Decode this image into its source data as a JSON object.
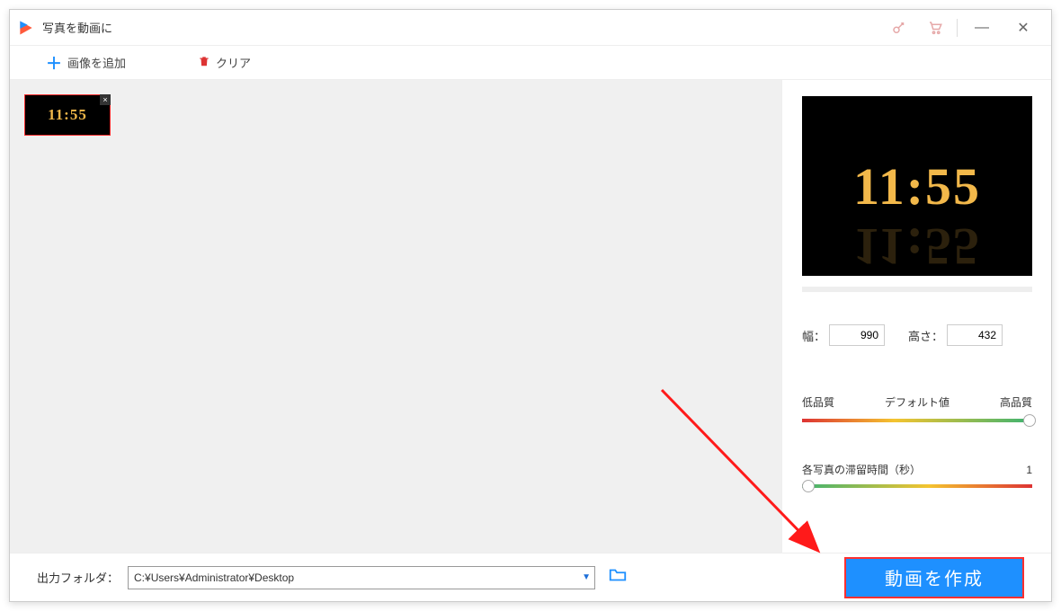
{
  "titlebar": {
    "app_title": "写真を動画に"
  },
  "toolbar": {
    "add_label": "画像を追加",
    "clear_label": "クリア"
  },
  "thumbnail": {
    "text": "11:55",
    "close": "×"
  },
  "preview": {
    "text": "11:55"
  },
  "dims": {
    "width_label": "幅：",
    "width_value": "990",
    "height_label": "高さ：",
    "height_value": "432"
  },
  "quality": {
    "low_label": "低品質",
    "default_label": "デフォルト値",
    "high_label": "高品質"
  },
  "duration": {
    "label": "各写真の滞留時間（秒）",
    "value": "1"
  },
  "bottom": {
    "output_label": "出力フォルダ：",
    "output_path": "C:¥Users¥Administrator¥Desktop",
    "create_label": "動画を作成"
  },
  "win": {
    "minimize": "—",
    "close": "✕"
  }
}
